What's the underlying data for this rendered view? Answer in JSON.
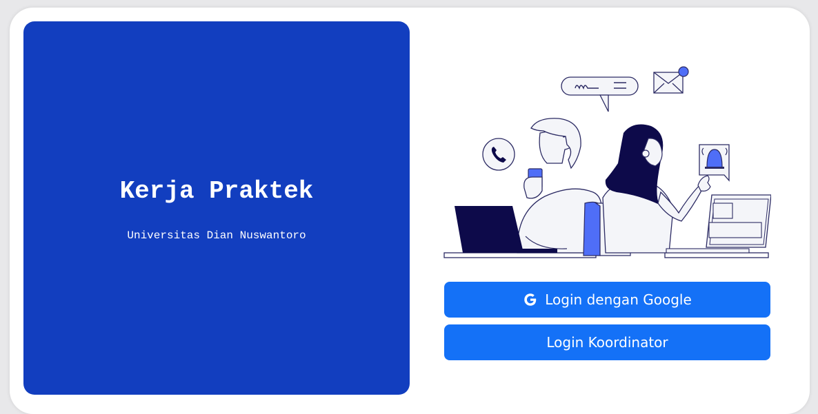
{
  "branding": {
    "title": "Kerja Praktek",
    "subtitle": "Universitas Dian Nuswantoro"
  },
  "actions": {
    "google_login_label": "Login dengan Google",
    "coordinator_login_label": "Login Koordinator"
  },
  "illustration": {
    "icons": [
      "phone-icon",
      "chat-bubble-icon",
      "mail-icon",
      "bell-icon",
      "laptop-icon",
      "monitor-icon",
      "smartphone-icon"
    ]
  },
  "colors": {
    "panel_blue": "#123ebf",
    "button_blue": "#1471f7",
    "accent_blue": "#4f6ef7",
    "navy": "#0d0a4a"
  }
}
